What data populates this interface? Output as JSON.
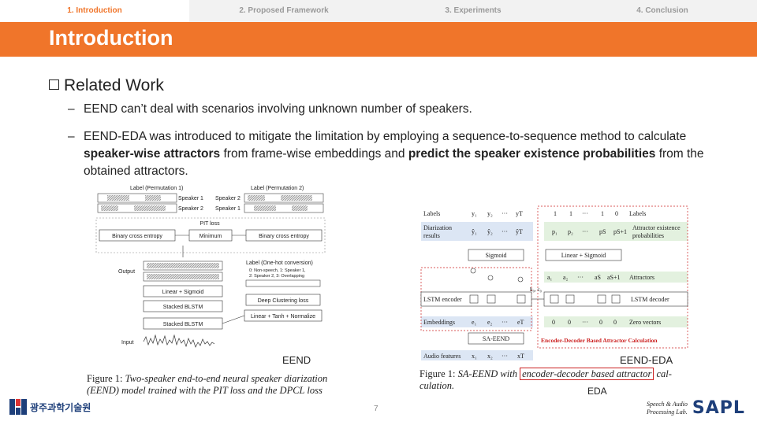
{
  "nav": {
    "tabs": [
      {
        "label": "1. Introduction",
        "active": true
      },
      {
        "label": "2. Proposed Framework",
        "active": false
      },
      {
        "label": "3. Experiments",
        "active": false
      },
      {
        "label": "4. Conclusion",
        "active": false
      }
    ]
  },
  "title": "Introduction",
  "section": {
    "heading": "Related Work"
  },
  "bullets": {
    "b1": "EEND can’t deal with scenarios involving unknown number of speakers.",
    "b2_pre": "EEND-EDA was introduced to mitigate the limitation by employing a sequence-to-sequence method to calculate ",
    "b2_bold1": "speaker-wise attractors",
    "b2_mid": " from frame-wise embeddings and ",
    "b2_bold2": "predict the speaker existence probabilities",
    "b2_post": " from the obtained attractors."
  },
  "fig_left": {
    "label_perm1": "Label (Permutation 1)",
    "label_perm2": "Label (Permutation 2)",
    "spk1": "Speaker 1",
    "spk2": "Speaker 2",
    "spk2b": "Speaker 2",
    "spk1b": "Speaker 1",
    "pit_loss": "PIT loss",
    "bce1": "Binary cross entropy",
    "minimum": "Minimum",
    "bce2": "Binary cross entropy",
    "output": "Output",
    "onehot": "Label (One-hot conversion)",
    "onehot_l1": "0: Non-speech, 1: Speaker 1,",
    "onehot_l2": "2: Speaker 2, 3: Overlapping",
    "linear_sigmoid": "Linear + Sigmoid",
    "stacked_blstm1": "Stacked BLSTM",
    "deep_clustering": "Deep Clustering loss",
    "stacked_blstm2": "Stacked BLSTM",
    "lin_tanh_norm": "Linear + Tanh + Normalize",
    "input": "Input",
    "label": "EEND",
    "caption_prefix": "Figure 1:",
    "caption_l1": "Two-speaker end-to-end neural speaker diarization",
    "caption_l2": "(EEND) model trained with the PIT loss and the DPCL loss"
  },
  "fig_right": {
    "labels": "Labels",
    "y1": "y₁",
    "y2": "y₂",
    "ydots": "···",
    "yT": "yT",
    "one1": "1",
    "one2": "1",
    "one_dots": "···",
    "one3": "1",
    "zero": "0",
    "labels_r": "Labels",
    "diar_results_1": "Diarization",
    "diar_results_2": "results",
    "yh1": "ŷ₁",
    "yh2": "ŷ₂",
    "yhdots": "···",
    "yhT": "ŷT",
    "p1": "p₁",
    "p2": "p₂",
    "pdots": "···",
    "pS": "pS",
    "pS1": "pS+1",
    "attr_exist_1": "Attractor existence",
    "attr_exist_2": "probabilities",
    "sigmoid": "Sigmoid",
    "lin_sigmoid": "Linear + Sigmoid",
    "a1": "a₁",
    "a2": "a₂",
    "adots": "···",
    "aS": "aS",
    "aS1": "aS+1",
    "attractors": "Attractors",
    "lstm_enc": "LSTM encoder",
    "h0c0": "h₀, c₀",
    "lstm_dec": "LSTM decoder",
    "embeddings": "Embeddings",
    "e1": "e₁",
    "e2": "e₂",
    "edots": "···",
    "eT": "eT",
    "z1": "0",
    "z2": "0",
    "zdots": "···",
    "z3": "0",
    "z4": "0",
    "zero_vectors": "Zero vectors",
    "sa_eend": "SA-EEND",
    "eda_title": "Encoder-Decoder Based Attractor Calculation",
    "audio": "Audio features",
    "x1": "x₁",
    "x2": "x₂",
    "xdots": "···",
    "xT": "xT",
    "label": "EEND-EDA",
    "caption_prefix": "Figure 1:",
    "caption_pre": "SA-EEND with",
    "caption_box": "encoder-decoder based attractor",
    "caption_post": "cal-",
    "caption_l2": "culation.",
    "eda_label": "EDA"
  },
  "footer": {
    "page": "7",
    "lab_line1": "Speech & Audio",
    "lab_line2": "Processing Lab.",
    "lab_logo": "SAPL",
    "uni_name": "광주과학기술원"
  },
  "colors": {
    "accent": "#f0752a",
    "blue_band": "#dce6f4",
    "green_band": "#e3f1df",
    "red": "#cc2222"
  }
}
